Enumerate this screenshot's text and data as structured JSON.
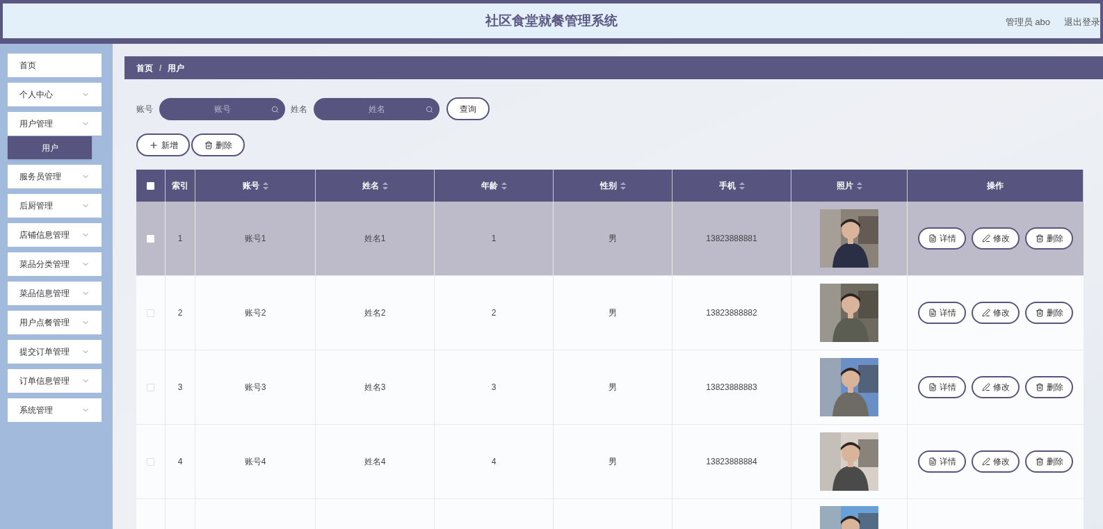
{
  "header": {
    "title": "社区食堂就餐管理系统",
    "user": "管理员 abo",
    "logout": "退出登录"
  },
  "sidebar": {
    "items": [
      {
        "label": "首页",
        "expandable": false
      },
      {
        "label": "个人中心",
        "expandable": true
      },
      {
        "label": "用户管理",
        "expandable": true,
        "children": [
          {
            "label": "用户",
            "selected": true
          }
        ]
      },
      {
        "label": "服务员管理",
        "expandable": true
      },
      {
        "label": "后厨管理",
        "expandable": true
      },
      {
        "label": "店铺信息管理",
        "expandable": true
      },
      {
        "label": "菜品分类管理",
        "expandable": true
      },
      {
        "label": "菜品信息管理",
        "expandable": true
      },
      {
        "label": "用户点餐管理",
        "expandable": true
      },
      {
        "label": "提交订单管理",
        "expandable": true
      },
      {
        "label": "订单信息管理",
        "expandable": true
      },
      {
        "label": "系统管理",
        "expandable": true
      }
    ]
  },
  "breadcrumb": {
    "items": [
      "首页",
      "用户"
    ],
    "separator": "/"
  },
  "search": {
    "fields": [
      {
        "label": "账号",
        "placeholder": "账号"
      },
      {
        "label": "姓名",
        "placeholder": "姓名"
      }
    ],
    "button": "查询"
  },
  "actions": [
    {
      "kind": "add",
      "label": "新增"
    },
    {
      "kind": "delete",
      "label": "删除"
    }
  ],
  "table": {
    "select_all_checked": false,
    "columns": [
      {
        "label": "索引",
        "sortable": false
      },
      {
        "label": "账号",
        "sortable": true
      },
      {
        "label": "姓名",
        "sortable": true
      },
      {
        "label": "年龄",
        "sortable": true
      },
      {
        "label": "性别",
        "sortable": true
      },
      {
        "label": "手机",
        "sortable": true
      },
      {
        "label": "照片",
        "sortable": true
      },
      {
        "label": "操作",
        "sortable": false
      }
    ],
    "rows": [
      {
        "index": "1",
        "account": "账号1",
        "name": "姓名1",
        "age": "1",
        "gender": "男",
        "phone": "13823888881",
        "highlighted": true,
        "checked": false,
        "actions": [
          {
            "kind": "detail",
            "label": "详情"
          },
          {
            "kind": "edit",
            "label": "修改"
          },
          {
            "kind": "delete",
            "label": "删除"
          }
        ]
      },
      {
        "index": "2",
        "account": "账号2",
        "name": "姓名2",
        "age": "2",
        "gender": "男",
        "phone": "13823888882",
        "highlighted": false,
        "checked": false,
        "actions": [
          {
            "kind": "detail",
            "label": "详情"
          },
          {
            "kind": "edit",
            "label": "修改"
          },
          {
            "kind": "delete",
            "label": "删除"
          }
        ]
      },
      {
        "index": "3",
        "account": "账号3",
        "name": "姓名3",
        "age": "3",
        "gender": "男",
        "phone": "13823888883",
        "highlighted": false,
        "checked": false,
        "actions": [
          {
            "kind": "detail",
            "label": "详情"
          },
          {
            "kind": "edit",
            "label": "修改"
          },
          {
            "kind": "delete",
            "label": "删除"
          }
        ]
      },
      {
        "index": "4",
        "account": "账号4",
        "name": "姓名4",
        "age": "4",
        "gender": "男",
        "phone": "13823888884",
        "highlighted": false,
        "checked": false,
        "actions": [
          {
            "kind": "detail",
            "label": "详情"
          },
          {
            "kind": "edit",
            "label": "修改"
          },
          {
            "kind": "delete",
            "label": "删除"
          }
        ]
      }
    ]
  }
}
